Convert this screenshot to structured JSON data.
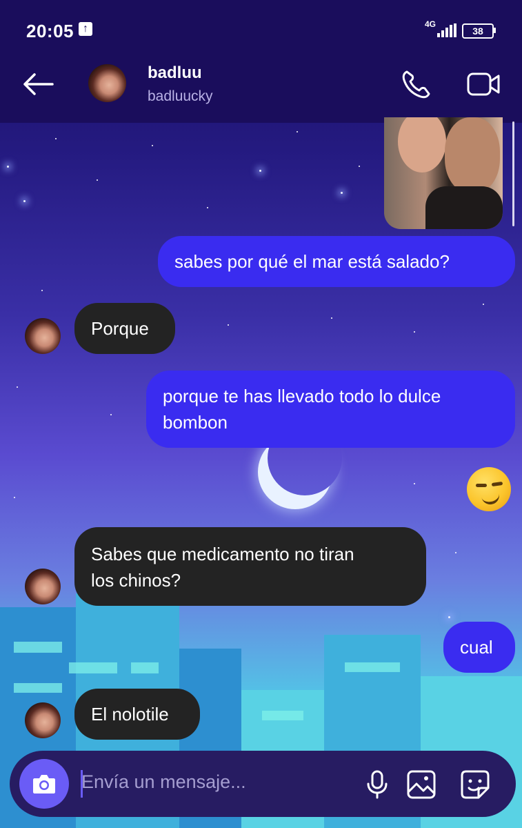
{
  "status_bar": {
    "time": "20:05",
    "network": "4G",
    "battery": "38"
  },
  "header": {
    "name": "badluu",
    "username": "badluucky",
    "icons": [
      "back-arrow-icon",
      "avatar",
      "phone-icon",
      "video-camera-icon"
    ]
  },
  "messages": [
    {
      "side": "out",
      "type": "photo"
    },
    {
      "side": "out",
      "text": "sabes por qué el mar está salado?"
    },
    {
      "side": "in",
      "text": "Porque"
    },
    {
      "side": "out",
      "line1": "porque te has llevado todo lo dulce",
      "line2": "bombon"
    },
    {
      "side": "out",
      "type": "emoji",
      "emoji": "smirking-face"
    },
    {
      "side": "in",
      "line1": "Sabes que medicamento no tiran",
      "line2": "los chinos?"
    },
    {
      "side": "out",
      "text": "cual"
    },
    {
      "side": "in",
      "text": "El nolotile"
    }
  ],
  "composer": {
    "placeholder": "Envía un mensaje...",
    "icons": [
      "camera-icon",
      "microphone-icon",
      "image-icon",
      "sticker-icon"
    ]
  },
  "colors": {
    "outgoing": "#3a2cf0",
    "incoming": "#232323",
    "accent": "#6a5cf6",
    "bar": "#1a0d5c"
  }
}
